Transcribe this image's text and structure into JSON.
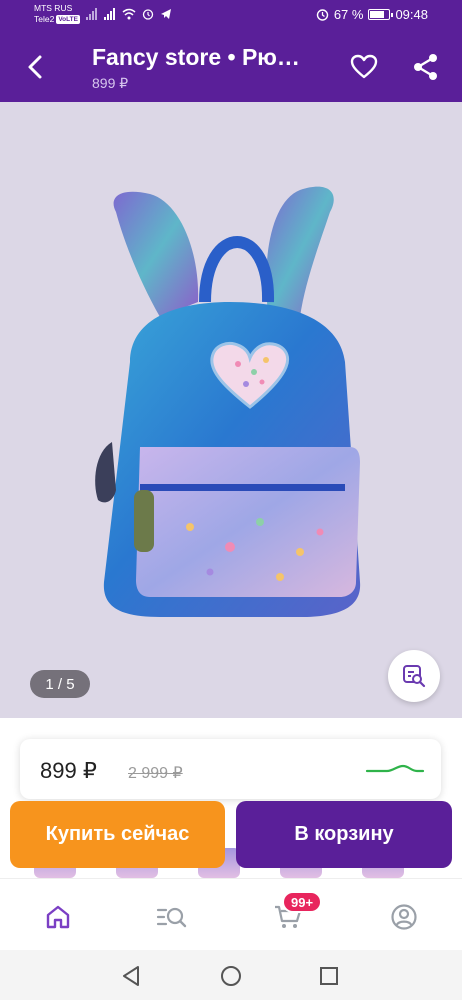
{
  "status_bar": {
    "carrier_1": "MTS RUS",
    "carrier_2": "Tele2",
    "volte_badge": "VoLTE",
    "battery": "67 %",
    "battery_level": 0.67,
    "time": "09:48"
  },
  "header": {
    "title": "Fancy store • Рю…",
    "subtitle": "899 ₽"
  },
  "gallery": {
    "counter": "1 / 5",
    "image_description": "Holographic mini backpack with bunny ears"
  },
  "price_card": {
    "price": "899 ₽",
    "old_price": "2 999 ₽"
  },
  "actions": {
    "buy_now": "Купить сейчас",
    "add_to_cart": "В корзину"
  },
  "bottom_nav": {
    "cart_badge": "99+"
  },
  "colors": {
    "brand": "#5a1f99",
    "buy_now": "#f7941d",
    "badge": "#e8255d",
    "price_trend": "#2fb34a"
  },
  "icons": {
    "back": "back-arrow-icon",
    "favorite": "heart-icon",
    "share": "share-icon",
    "visual_search": "visual-search-icon",
    "home": "home-icon",
    "catalog": "catalog-search-icon",
    "cart": "cart-icon",
    "profile": "profile-icon"
  }
}
